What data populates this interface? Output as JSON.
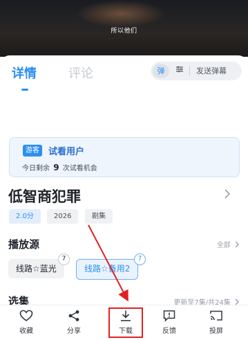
{
  "video": {
    "subtitle": "所以他们"
  },
  "tabs": {
    "details": "详情",
    "comments": "评论"
  },
  "danmu": {
    "toggle_label": "弹",
    "send_label": "发送弹幕"
  },
  "guest": {
    "badge": "游客",
    "title": "试看用户",
    "remaining_prefix": "今日剩余",
    "remaining_count": "9",
    "remaining_suffix": "次试看机会"
  },
  "show": {
    "title": "低智商犯罪",
    "score": "2.0分",
    "year": "2026",
    "genre": "剧集"
  },
  "sources": {
    "section_title": "播放源",
    "all_label": "全部",
    "items": [
      {
        "label": "线路☆蓝光",
        "count": "7",
        "selected": false
      },
      {
        "label": "线路☆备用2",
        "count": "7",
        "selected": true
      }
    ]
  },
  "episodes": {
    "section_title": "选集",
    "update_info": "更新至7集/共24集"
  },
  "actions": [
    {
      "label": "收藏",
      "icon": "heart-icon"
    },
    {
      "label": "分享",
      "icon": "share-icon"
    },
    {
      "label": "下载",
      "icon": "download-icon"
    },
    {
      "label": "反馈",
      "icon": "feedback-icon"
    },
    {
      "label": "投屏",
      "icon": "cast-icon"
    }
  ],
  "colors": {
    "accent": "#2b8ff3",
    "highlight": "#e02020"
  }
}
